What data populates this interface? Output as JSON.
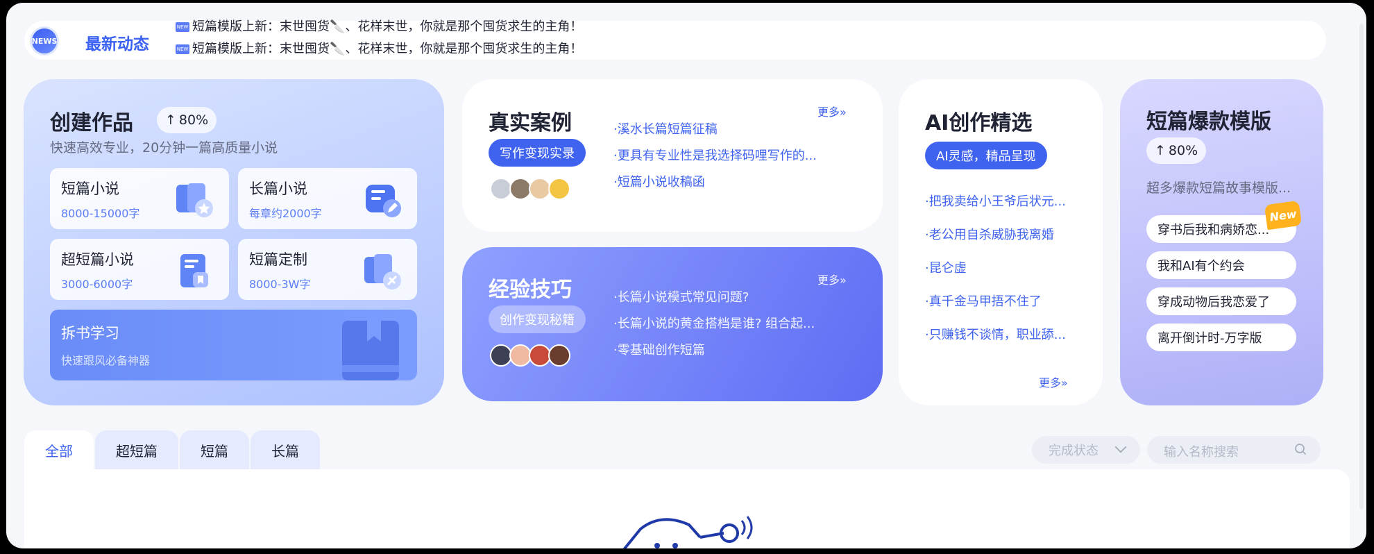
{
  "news": {
    "icon": "news-icon",
    "icon_text": "NEWS",
    "title": "最新动态",
    "lines": [
      "短篇模版上新：末世囤货🔪、花样末世，你就是那个囤货求生的主角！",
      "短篇模版上新：末世囤货🔪、花样末世，你就是那个囤货求生的主角！"
    ],
    "new_badge": "NEW"
  },
  "create": {
    "title": "创建作品",
    "badge": "80%",
    "subtitle": "快速高效专业，20分钟一篇高质量小说",
    "tiles": [
      {
        "title": "短篇小说",
        "sub": "8000-15000字",
        "icon": "book-star-icon"
      },
      {
        "title": "长篇小说",
        "sub": "每章约2000字",
        "icon": "book-edit-icon"
      },
      {
        "title": "超短篇小说",
        "sub": "3000-6000字",
        "icon": "bookmark-doc-icon"
      },
      {
        "title": "短篇定制",
        "sub": "8000-3W字",
        "icon": "book-tools-icon"
      }
    ],
    "study": {
      "title": "拆书学习",
      "sub": "快速跟风必备神器"
    }
  },
  "real": {
    "title": "真实案例",
    "pill": "写作变现实录",
    "more": "更多»",
    "links": [
      "·溪水长篇短篇征稿",
      "·更具有专业性是我选择码哩写作的...",
      "·短篇小说收稿函"
    ]
  },
  "exp": {
    "title": "经验技巧",
    "pill": "创作变现秘籍",
    "more": "更多»",
    "links": [
      "·长篇小说模式常见问题?",
      "·长篇小说的黄金搭档是谁? 组合起...",
      "·零基础创作短篇"
    ]
  },
  "ai": {
    "title": "AI创作精选",
    "pill": "AI灵感，精品呈现",
    "links": [
      "·把我卖给小王爷后状元...",
      "·老公用自杀威胁我离婚",
      "·昆仑虚",
      "·真千金马甲捂不住了",
      "·只赚钱不谈情，职业舔..."
    ],
    "more": "更多»"
  },
  "tpl": {
    "title": "短篇爆款模版",
    "badge": "80%",
    "subtitle": "超多爆款短篇故事模版...",
    "new_tag": "New",
    "items": [
      "穿书后我和病娇恋...",
      "我和AI有个约会",
      "穿成动物后我恋爱了",
      "离开倒计时-万字版"
    ]
  },
  "tabs": [
    "全部",
    "超短篇",
    "短篇",
    "长篇"
  ],
  "filter": {
    "status_placeholder": "完成状态",
    "search_placeholder": "输入名称搜索"
  },
  "colors": {
    "accent": "#3f63ef",
    "page_bg": "#f6f7fb"
  }
}
